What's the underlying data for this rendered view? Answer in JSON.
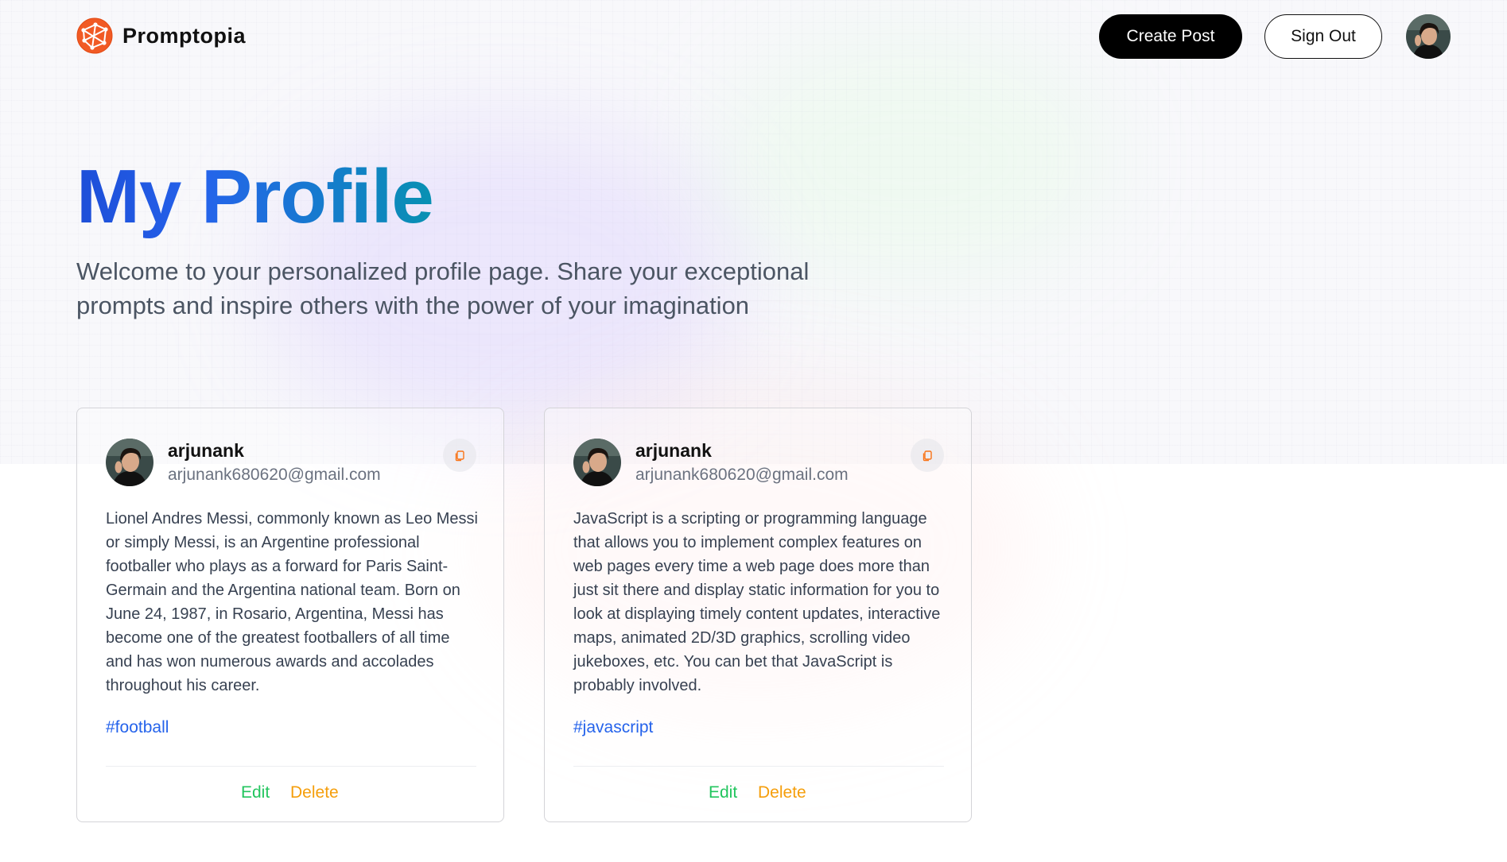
{
  "brand": {
    "name": "Promptopia",
    "logo_icon": "globe-network-icon",
    "accent": "#f97316"
  },
  "nav": {
    "create_post": "Create Post",
    "sign_out": "Sign Out",
    "avatar_icon": "user-avatar"
  },
  "header": {
    "title": "My Profile",
    "description": "Welcome to your personalized profile page. Share your exceptional prompts and inspire others with the power of your imagination",
    "title_gradient": [
      "#1d4ed8",
      "#0891b2"
    ]
  },
  "posts": [
    {
      "username": "arjunank",
      "email": "arjunank680620@gmail.com",
      "prompt": "Lionel Andres Messi, commonly known as Leo Messi or simply Messi, is an Argentine professional footballer who plays as a forward for Paris Saint-Germain and the Argentina national team. Born on June 24, 1987, in Rosario, Argentina, Messi has become one of the greatest footballers of all time and has won numerous awards and accolades throughout his career.",
      "tag": "#football",
      "edit_label": "Edit",
      "delete_label": "Delete",
      "copy_icon": "copy-icon"
    },
    {
      "username": "arjunank",
      "email": "arjunank680620@gmail.com",
      "prompt": "JavaScript is a scripting or programming language that allows you to implement complex features on web pages every time a web page does more than just sit there and display static information for you to look at displaying timely content updates, interactive maps, animated 2D/3D graphics, scrolling video jukeboxes, etc. You can bet that JavaScript is probably involved.",
      "tag": "#javascript",
      "edit_label": "Edit",
      "delete_label": "Delete",
      "copy_icon": "copy-icon"
    }
  ],
  "colors": {
    "tag": "#2563eb",
    "edit": "#22c55e",
    "delete": "#f59e0b"
  }
}
